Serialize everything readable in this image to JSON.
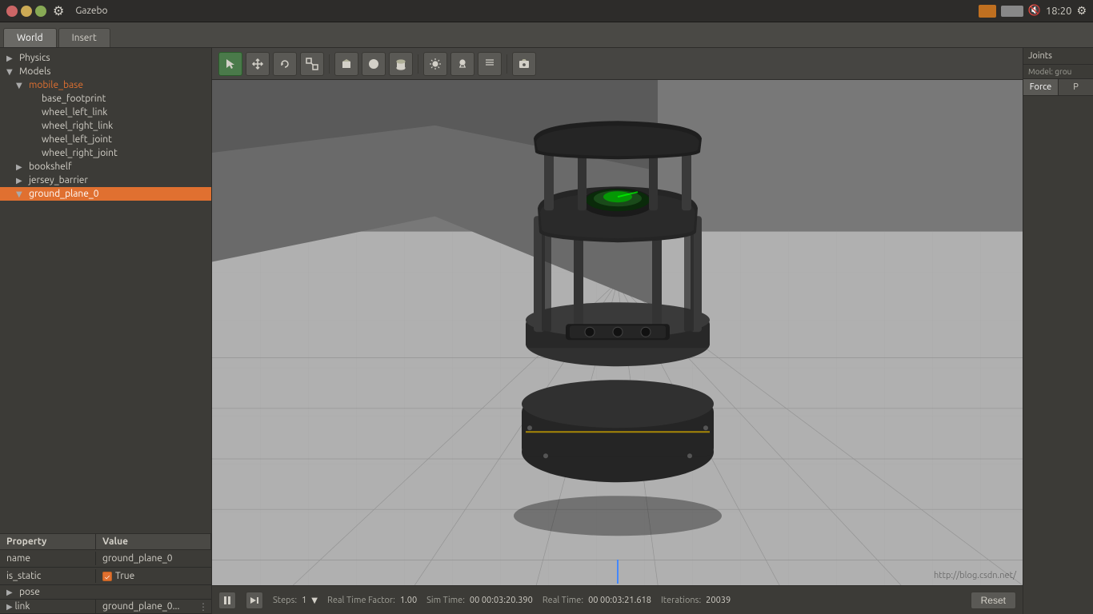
{
  "window": {
    "title": "Gazebo",
    "time": "18:20"
  },
  "tabs": {
    "main": [
      {
        "label": "World",
        "active": true
      },
      {
        "label": "Insert",
        "active": false
      }
    ]
  },
  "tree": {
    "physics_label": "Physics",
    "models_label": "Models",
    "mobile_base_label": "mobile_base",
    "base_footprint_label": "base_footprint",
    "wheel_left_link_label": "wheel_left_link",
    "wheel_right_link_label": "wheel_right_link",
    "wheel_left_joint_label": "wheel_left_joint",
    "wheel_right_joint_label": "wheel_right_joint",
    "bookshelf_label": "bookshelf",
    "jersey_barrier_label": "jersey_barrier",
    "ground_plane_label": "ground_plane_0"
  },
  "properties": {
    "header_property": "Property",
    "header_value": "Value",
    "name_key": "name",
    "name_val": "ground_plane_0",
    "is_static_key": "is_static",
    "is_static_val": "True",
    "pose_key": "pose",
    "link_key": "link",
    "link_val": "ground_plane_0..."
  },
  "toolbar": {
    "buttons": [
      {
        "name": "select",
        "icon": "↖",
        "active": true
      },
      {
        "name": "translate",
        "icon": "✛",
        "active": false
      },
      {
        "name": "rotate",
        "icon": "↻",
        "active": false
      },
      {
        "name": "scale",
        "icon": "⤢",
        "active": false
      },
      {
        "name": "separator1",
        "type": "sep"
      },
      {
        "name": "box",
        "icon": "▬",
        "active": false
      },
      {
        "name": "sphere",
        "icon": "●",
        "active": false
      },
      {
        "name": "cylinder",
        "icon": "⬜",
        "active": false
      },
      {
        "name": "separator2",
        "type": "sep"
      },
      {
        "name": "sun",
        "icon": "☀",
        "active": false
      },
      {
        "name": "pointlight",
        "icon": "✦",
        "active": false
      },
      {
        "name": "spotlight",
        "icon": "≡",
        "active": false
      },
      {
        "name": "separator3",
        "type": "sep"
      },
      {
        "name": "camera",
        "icon": "📷",
        "active": false
      }
    ]
  },
  "statusbar": {
    "steps_label": "Steps:",
    "steps_val": "1",
    "rtf_label": "Real Time Factor:",
    "rtf_val": "1.00",
    "simtime_label": "Sim Time:",
    "simtime_val": "00 00:03:20.390",
    "realtime_label": "Real Time:",
    "realtime_val": "00 00:03:21.618",
    "iterations_label": "Iterations:",
    "iterations_val": "20039",
    "reset_label": "Reset"
  },
  "right_panel": {
    "joints_label": "Joints",
    "model_label": "Model: grou",
    "force_label": "Force",
    "p_label": "P"
  },
  "watermark": "http://blog.csdn.net/"
}
